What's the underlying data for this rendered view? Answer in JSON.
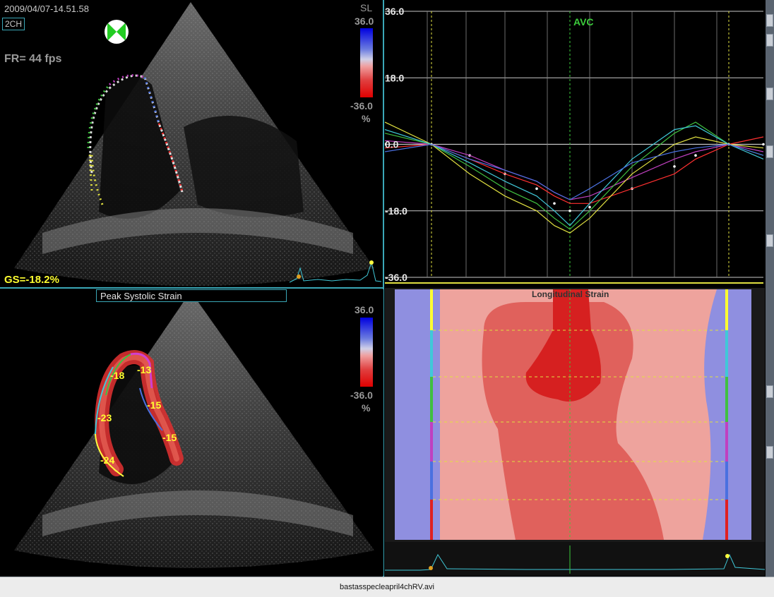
{
  "topLeft": {
    "timestamp": "2009/04/07-14.51.58",
    "view": "2CH",
    "frameRate": "FR=  44 fps",
    "globalStrain": "GS=-18.2%",
    "scale": {
      "mode": "SL",
      "max": "36.0",
      "min": "-36.0",
      "unit": "%"
    }
  },
  "bottomLeft": {
    "title": "Peak Systolic Strain",
    "scale": {
      "max": "36.0",
      "min": "-36.0",
      "unit": "%"
    },
    "segmentValues": [
      "-13",
      "-18",
      "-15",
      "-23",
      "-15",
      "-24"
    ]
  },
  "chart": {
    "event_label": "AVC",
    "y_ticks": [
      "36.0",
      "18.0",
      "0.0",
      "-18.0",
      "-36.0"
    ]
  },
  "chart_data": {
    "type": "line",
    "ylim": [
      -36,
      36
    ],
    "series": [
      {
        "color": "#ffffff",
        "dotted": true,
        "values": [
          0,
          0,
          -3,
          -8,
          -12,
          -16,
          -18,
          -17,
          -12,
          -6,
          -3,
          0,
          0
        ]
      },
      {
        "color": "#c040c0",
        "values": [
          1,
          0,
          -3,
          -7,
          -10,
          -13,
          -15,
          -14,
          -9,
          -4,
          -2,
          0,
          -2
        ]
      },
      {
        "color": "#ff3030",
        "values": [
          -1,
          0,
          -4,
          -8,
          -11,
          -14,
          -16,
          -16,
          -12,
          -8,
          -4,
          0,
          2
        ]
      },
      {
        "color": "#40c040",
        "values": [
          3,
          0,
          -6,
          -12,
          -16,
          -20,
          -23,
          -18,
          -6,
          3,
          6,
          0,
          -3
        ]
      },
      {
        "color": "#e0e040",
        "values": [
          6,
          0,
          -8,
          -14,
          -18,
          -22,
          -24,
          -20,
          -8,
          0,
          2,
          0,
          -1
        ]
      },
      {
        "color": "#40c8d8",
        "values": [
          4,
          0,
          -5,
          -10,
          -14,
          -18,
          -22,
          -16,
          -4,
          4,
          5,
          0,
          -4
        ]
      },
      {
        "color": "#4a70e0",
        "values": [
          -2,
          0,
          -4,
          -7,
          -10,
          -13,
          -15,
          -12,
          -5,
          -2,
          -1,
          0,
          -3
        ]
      }
    ]
  },
  "heatmap": {
    "title": "Longitudinal Strain",
    "colors": {
      "strong": "#d62020",
      "medium": "#e0615c",
      "light": "#eea39d",
      "blue": "#8f8fe0"
    }
  },
  "statusbar": {
    "filename": "bastasspecleapril4chRV.avi"
  }
}
